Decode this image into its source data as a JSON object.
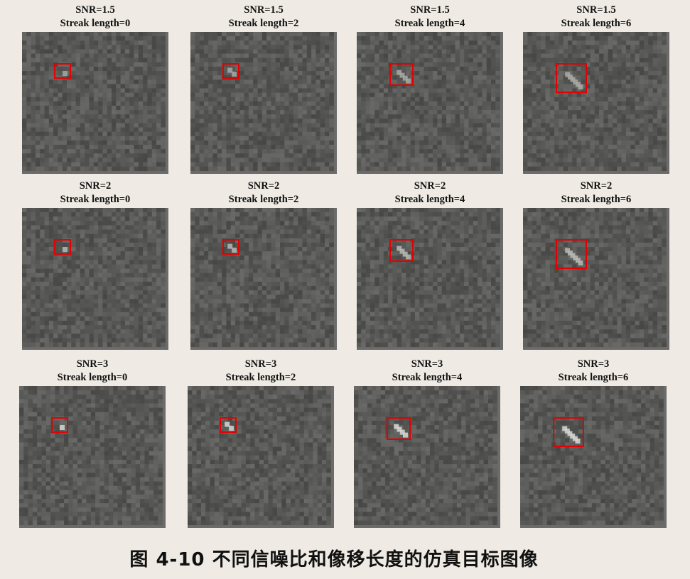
{
  "figure": {
    "caption": "图 4-10  不同信噪比和像移长度的仿真目标图像"
  },
  "panels": [
    {
      "snr": "SNR=1.5",
      "streak": "Streak length=0",
      "snr_value": 1.5,
      "streak_length": 0
    },
    {
      "snr": "SNR=1.5",
      "streak": "Streak length=2",
      "snr_value": 1.5,
      "streak_length": 2
    },
    {
      "snr": "SNR=1.5",
      "streak": "Streak length=4",
      "snr_value": 1.5,
      "streak_length": 4
    },
    {
      "snr": "SNR=1.5",
      "streak": "Streak length=6",
      "snr_value": 1.5,
      "streak_length": 6
    },
    {
      "snr": "SNR=2",
      "streak": "Streak length=0",
      "snr_value": 2,
      "streak_length": 0
    },
    {
      "snr": "SNR=2",
      "streak": "Streak length=2",
      "snr_value": 2,
      "streak_length": 2
    },
    {
      "snr": "SNR=2",
      "streak": "Streak length=4",
      "snr_value": 2,
      "streak_length": 4
    },
    {
      "snr": "SNR=2",
      "streak": "Streak length=6",
      "snr_value": 2,
      "streak_length": 6
    },
    {
      "snr": "SNR=3",
      "streak": "Streak length=0",
      "snr_value": 3,
      "streak_length": 0
    },
    {
      "snr": "SNR=3",
      "streak": "Streak length=2",
      "snr_value": 3,
      "streak_length": 2
    },
    {
      "snr": "SNR=3",
      "streak": "Streak length=4",
      "snr_value": 3,
      "streak_length": 4
    },
    {
      "snr": "SNR=3",
      "streak": "Streak length=6",
      "snr_value": 3,
      "streak_length": 6
    }
  ],
  "colors": {
    "background": "#efebe4",
    "target_box": "#e60000",
    "noise_base": "#6b6b6b"
  }
}
